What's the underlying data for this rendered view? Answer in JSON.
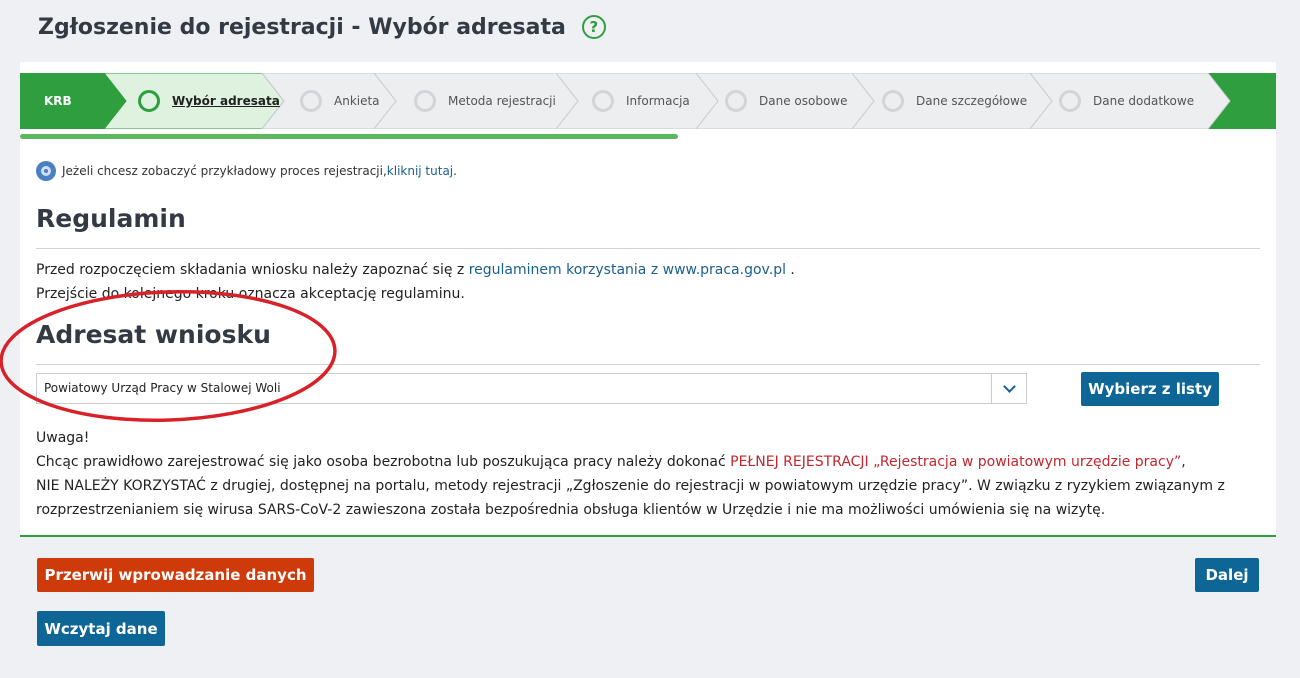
{
  "header": {
    "title": "Zgłoszenie do rejestracji - Wybór adresata",
    "help_icon": "?"
  },
  "stepper": {
    "first": "KRB",
    "steps": [
      {
        "label": "Wybór adresata",
        "active": true
      },
      {
        "label": "Ankieta",
        "active": false
      },
      {
        "label": "Metoda rejestracji",
        "active": false
      },
      {
        "label": "Informacja",
        "active": false
      },
      {
        "label": "Dane osobowe",
        "active": false
      },
      {
        "label": "Dane szczegółowe",
        "active": false
      },
      {
        "label": "Dane dodatkowe",
        "active": false
      }
    ]
  },
  "info": {
    "text": "Jeżeli chcesz zobaczyć przykładowy proces rejestracji, ",
    "link": "kliknij tutaj",
    "suffix": "."
  },
  "regulamin": {
    "title": "Regulamin",
    "line1_pre": "Przed rozpoczęciem składania wniosku należy zapoznać się z ",
    "line1_link": "regulaminem korzystania z www.praca.gov.pl",
    "line1_post": " .",
    "line2": "Przejście do kolejnego kroku oznacza akceptację regulaminu."
  },
  "adresat": {
    "title": "Adresat wniosku",
    "selected": "Powiatowy Urząd Pracy w Stalowej Woli",
    "choose_button": "Wybierz z listy"
  },
  "warning": {
    "heading": "Uwaga!",
    "p1_pre": "Chcąc prawidłowo zarejestrować się jako osoba bezrobotna lub poszukująca pracy należy dokonać ",
    "p1_red": "PEŁNEJ REJESTRACJI „Rejestracja w powiatowym urzędzie pracy”",
    "p1_post": ",",
    "p2": "NIE NALEŻY KORZYSTAĆ z drugiej, dostępnej na portalu, metody rejestracji „Zgłoszenie do rejestracji w powiatowym urzędzie pracy”. W związku z ryzykiem związanym z rozprzestrzenianiem się wirusa SARS-CoV-2 zawieszona została bezpośrednia obsługa klientów w Urzędzie i nie ma możliwości umówienia się na wizytę."
  },
  "footer": {
    "cancel_button": "Przerwij wprowadzanie danych",
    "next_button": "Dalej",
    "load_button": "Wczytaj dane"
  },
  "colors": {
    "brand_green": "#2e9e3e",
    "primary_blue": "#0e6696",
    "danger": "#cf3a0a",
    "annotation_red": "#d8222a"
  }
}
